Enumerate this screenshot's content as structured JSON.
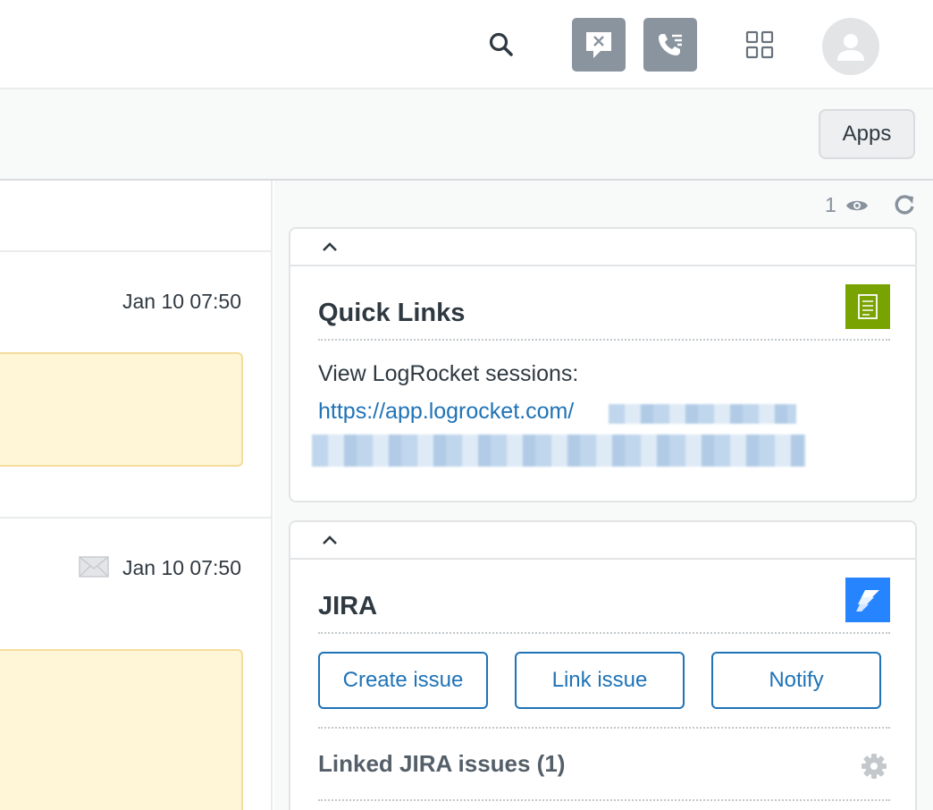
{
  "header": {
    "icons": [
      "search-icon",
      "chat-off-icon",
      "voice-icon",
      "product-tray-icon",
      "avatar-icon"
    ],
    "colors": {
      "icon_button_bg": "#8a949f",
      "avatar_bg": "#e2e4e6"
    }
  },
  "subheader": {
    "apps_label": "Apps"
  },
  "conversation": {
    "entries": [
      {
        "time": "Jan 10 07:50",
        "channel_icon": ""
      },
      {
        "time": "Jan 10 07:50",
        "channel_icon": "envelope-icon"
      }
    ],
    "colors": {
      "note_bg": "#fff6d7",
      "note_border": "#f3dd9c"
    }
  },
  "apps_panel": {
    "viewer_count": "1",
    "quick_links": {
      "title": "Quick Links",
      "text": "View LogRocket sessions:",
      "link_text": "https://app.logrocket.com/",
      "logo_color": "#78a300"
    },
    "jira": {
      "title": "JIRA",
      "buttons": {
        "create": "Create issue",
        "link": "Link issue",
        "notify": "Notify"
      },
      "linked_title": "Linked JIRA issues (1)",
      "logo_color": "#2684ff"
    },
    "colors": {
      "link": "#1f73b7"
    }
  }
}
